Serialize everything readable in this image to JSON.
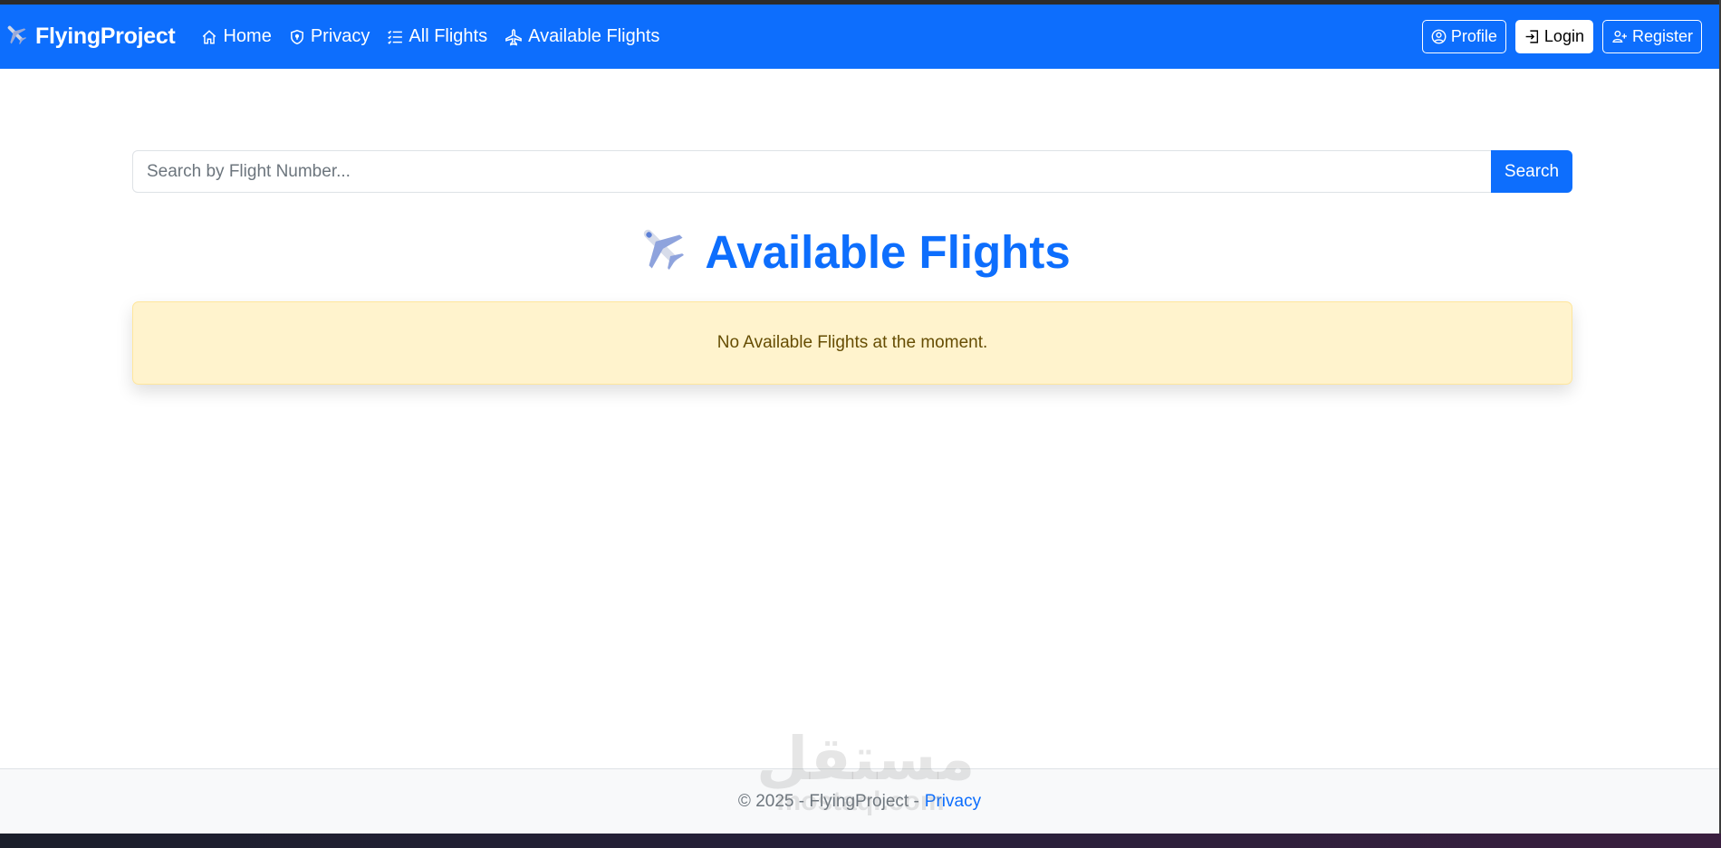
{
  "navbar": {
    "brand": "FlyingProject",
    "brand_icon": "airplane-emoji",
    "links": [
      {
        "label": "Home",
        "icon": "house-icon"
      },
      {
        "label": "Privacy",
        "icon": "shield-icon"
      },
      {
        "label": "All Flights",
        "icon": "list-check-icon"
      },
      {
        "label": "Available Flights",
        "icon": "airplane-outline-icon"
      }
    ],
    "profile_label": "Profile",
    "login_label": "Login",
    "register_label": "Register"
  },
  "search": {
    "placeholder": "Search by Flight Number...",
    "button_label": "Search"
  },
  "main": {
    "heading": "Available Flights",
    "alert_message": "No Available Flights at the moment."
  },
  "footer": {
    "text": "© 2025 - FlyingProject -",
    "privacy_link": "Privacy"
  },
  "watermark": {
    "arabic": "مستقل",
    "latin": "mostaql.com"
  },
  "colors": {
    "primary": "#0d6efd",
    "alert_bg": "#fff3cd",
    "alert_text": "#664d03",
    "footer_bg": "#f8f9fa"
  }
}
